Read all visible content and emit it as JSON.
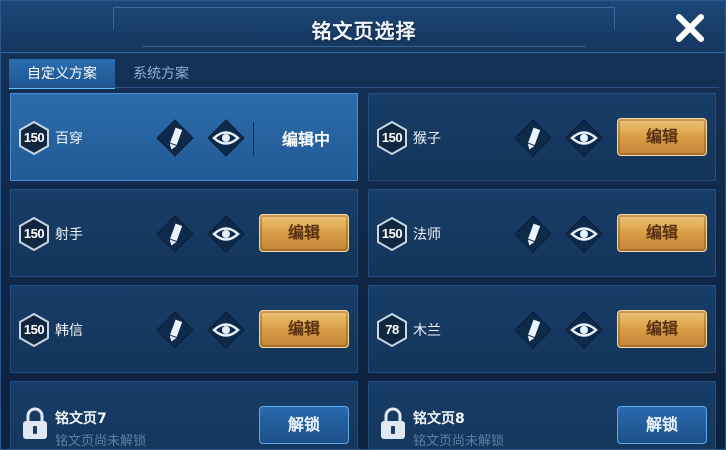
{
  "title": "铭文页选择",
  "tabs": [
    {
      "label": "自定义方案",
      "active": true
    },
    {
      "label": "系统方案",
      "active": false
    }
  ],
  "pages": [
    {
      "level": "150",
      "name": "百穿",
      "status": "编辑中",
      "selected": true
    },
    {
      "level": "150",
      "name": "猴子",
      "button": "编辑"
    },
    {
      "level": "150",
      "name": "射手",
      "button": "编辑"
    },
    {
      "level": "150",
      "name": "法师",
      "button": "编辑"
    },
    {
      "level": "150",
      "name": "韩信",
      "button": "编辑"
    },
    {
      "level": "78",
      "name": "木兰",
      "button": "编辑"
    }
  ],
  "locked": [
    {
      "name": "铭文页7",
      "subtitle": "铭文页尚未解锁",
      "button": "解锁"
    },
    {
      "name": "铭文页8",
      "subtitle": "铭文页尚未解锁",
      "button": "解锁"
    }
  ],
  "icons": {
    "close": "close-icon",
    "edit": "pen-icon",
    "preview": "eye-icon",
    "level": "hexagon-badge-icon",
    "lock": "lock-icon"
  },
  "colors": {
    "accent_gold": "#d79d45",
    "selected_blue": "#2c6cac",
    "background": "#0f2646"
  }
}
